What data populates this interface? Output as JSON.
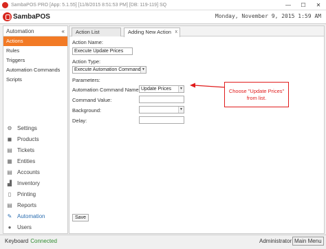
{
  "window": {
    "title": "SambaPOS PRO [App: 5.1.55] [11/8/2015 8:51:53 PM] [DB: 119-119] SQ",
    "minimize": "—",
    "maximize": "☐",
    "close": "✕"
  },
  "header": {
    "logo_text": "SambaPOS",
    "datetime": "Monday, November 9, 2015 1:59 AM"
  },
  "sidebar": {
    "title": "Automation",
    "collapse_glyph": "«",
    "items": [
      {
        "label": "Actions",
        "active": true
      },
      {
        "label": "Rules"
      },
      {
        "label": "Triggers"
      },
      {
        "label": "Automation Commands"
      },
      {
        "label": "Scripts"
      }
    ],
    "nav": [
      {
        "label": "Settings",
        "icon": "gear-icon",
        "glyph": "⚙"
      },
      {
        "label": "Products",
        "icon": "cube-icon",
        "glyph": "◼"
      },
      {
        "label": "Tickets",
        "icon": "ticket-icon",
        "glyph": "▤"
      },
      {
        "label": "Entities",
        "icon": "grid-icon",
        "glyph": "▦"
      },
      {
        "label": "Accounts",
        "icon": "ledger-icon",
        "glyph": "▤"
      },
      {
        "label": "Inventory",
        "icon": "chart-icon",
        "glyph": "▟"
      },
      {
        "label": "Printing",
        "icon": "document-icon",
        "glyph": "▯"
      },
      {
        "label": "Reports",
        "icon": "report-icon",
        "glyph": "▤"
      },
      {
        "label": "Automation",
        "icon": "wand-icon",
        "glyph": "✎",
        "active": true
      },
      {
        "label": "Users",
        "icon": "user-icon",
        "glyph": "●"
      }
    ]
  },
  "tabs": [
    {
      "label": "Action List"
    },
    {
      "label": "Adding New Action",
      "close": "x"
    }
  ],
  "form": {
    "action_name_label": "Action Name:",
    "action_name_value": "Execute Update Prices",
    "action_type_label": "Action Type:",
    "action_type_value": "Execute Automation Command",
    "parameters_label": "Parameters:",
    "cmd_name_label": "Automation Command Name:",
    "cmd_name_value": "Update Prices",
    "cmd_value_label": "Command Value:",
    "cmd_value_value": "",
    "background_label": "Background:",
    "background_value": "",
    "delay_label": "Delay:",
    "delay_value": "",
    "save_label": "Save",
    "dropdown_glyph": "▼"
  },
  "callout": {
    "line1": "Choose \"Update Prices\"",
    "line2": "from list.",
    "color": "#e01b1b"
  },
  "status": {
    "keyboard_label": "Keyboard",
    "connection": "Connected",
    "user": "Administrator",
    "main_menu": "Main Menu"
  },
  "colors": {
    "accent": "#f27a25",
    "brand": "#d8281f",
    "connected": "#2e8b2e"
  }
}
